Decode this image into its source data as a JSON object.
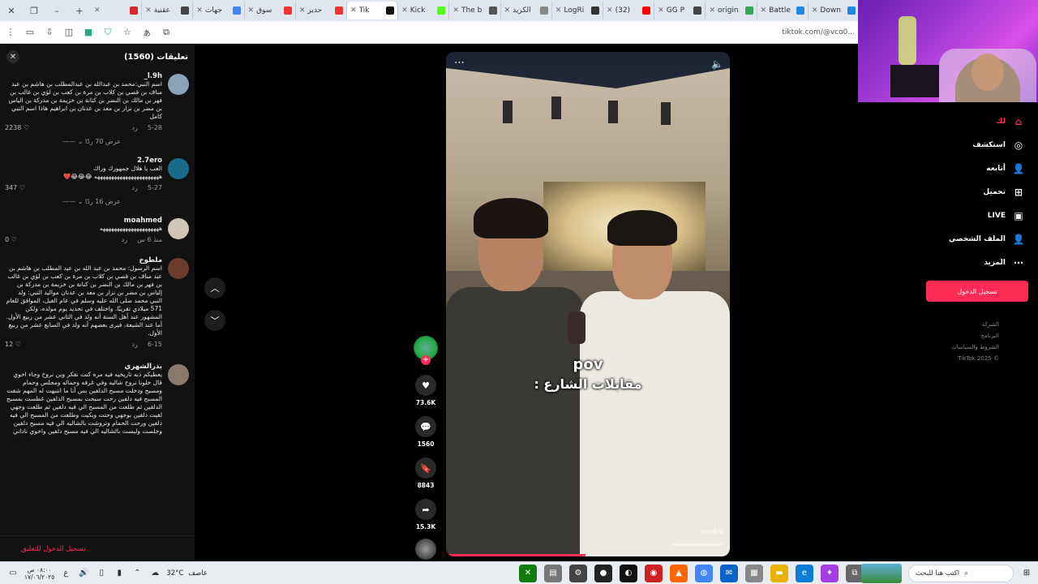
{
  "browser": {
    "tabs": [
      {
        "label": "",
        "color": "#d8262d"
      },
      {
        "label": "عقنية",
        "color": "#444444"
      },
      {
        "label": "جهات",
        "color": "#4285f4"
      },
      {
        "label": "سوق",
        "color": "#e33"
      },
      {
        "label": "حدير",
        "color": "#e33"
      },
      {
        "label": "Tik",
        "color": "#111111",
        "active": true
      },
      {
        "label": "Kick",
        "color": "#53fc18"
      },
      {
        "label": "The b",
        "color": "#555555"
      },
      {
        "label": "الكريد",
        "color": "#888888"
      },
      {
        "label": "LogRi",
        "color": "#333333"
      },
      {
        "label": "(32)",
        "color": "#ff0000"
      },
      {
        "label": "GG P",
        "color": "#444444"
      },
      {
        "label": "origin",
        "color": "#34a853"
      },
      {
        "label": "Battle",
        "color": "#1e88e5"
      },
      {
        "label": "Down",
        "color": "#1e88e5"
      }
    ],
    "url": "tiktok.com/@vco0..."
  },
  "comments": {
    "title": "تعليقات (1560)",
    "items": [
      {
        "user": "l.9h_",
        "text": "اسم النبي:محمد بن عبدالله بن عبدالمطلب بن هاشم بن عبد مناف بن قصي بن كلاب بن مرة بن كعب بن لؤي بن غالب بن فهر بن مالك بن النضر بن كنانة بن خزيمة بن مدركة بن الياس بن مضر بن نزار بن معد بن عدنان بن ابراهيم هاذا اسم النبي كامل",
        "date": "5-28",
        "reply": "رد",
        "likes": "2238",
        "replies_label": "عرض 70 ردًا",
        "avatar_color": "#8aa2b8"
      },
      {
        "user": "2.7ero",
        "text": "العب يا هلال جمهورك وراك",
        "text2": "هههههههههههههههههههههههه 😂😂😂❤️",
        "date": "5-27",
        "reply": "رد",
        "likes": "347",
        "replies_label": "عرض 16 ردًا",
        "avatar_color": "#1a6b8a"
      },
      {
        "user": "moahmed",
        "text": "هههههههههههههههههههههه",
        "date": "منذ 6 س",
        "reply": "رد",
        "likes": "0",
        "avatar_color": "#cfc6b8"
      },
      {
        "user": "ملطوخ",
        "text": "اسم الرسول: محمد بن عبد الله بن عبد المطلب بن هاشم بن عبد مناف بن قصي بن كلاب بن مرة بن كعب بن لؤي بن غالب بن فهر بن مالك بن النضر بن كنانة بن خزيمة بن مدركة بن إلياس بن مضر بن نزار بن معد بن عدنان مواليد النبي: ولد النبي محمد صلى الله عليه وسلم في عام الفيل، الموافق للعام 571 ميلادي تقريبًا. واختلف في تحديد يوم مولده، ولكن المشهور عند أهل السنة أنه ولد في الثاني عشر من ربيع الأول. أما عند الشيعة، فيرى بعضهم أنه ولد في السابع عشر من ربيع الأول.",
        "date": "6-15",
        "reply": "رد",
        "likes": "12",
        "avatar_color": "#6b3b2e"
      },
      {
        "user": "بدرالشهري",
        "text": "يعطيكم ذبه تاريخيه فيه مره كنت نفكر وين نروح وجاء اخوي قال خلونا نروح شاليه وفي غرفه وحماله ومجلس وحمام ومسبح ودخلت مسبح الدلفين بس أنا ما انتبهت له المهم شفت المسبح فيه دلفين رحت سبحت بمسبح الدلفين غطست بمسبح الدلفين ثم طلعت من المسبح الي فيه دلفين ثم طلعت وجهي لقيت دلفين بوجهي وحتت وبكيت وطلعت من المسبح الي فيه دلفين ورحت الحمام وتروشت بالشاليه الي فيه مسبح دلفين وخلصت ولبست بالشاليه الي فيه مسبح دلفين واخوي ناداني",
        "avatar_color": "#8a7a6a"
      }
    ],
    "login_label": "تسجيل الدخول للتعليق"
  },
  "video": {
    "caption_line1": "pov",
    "caption_line2": "مقابلات الشارع :",
    "handle": "vco0.0",
    "handle_sub": "هههههههههههههههههههه",
    "progress": 0.49
  },
  "actions": {
    "likes": "73.6K",
    "comments": "1560",
    "saves": "8843",
    "shares": "15.3K"
  },
  "sidebar": {
    "items": [
      {
        "label": "لك",
        "icon": "home-icon",
        "active": true
      },
      {
        "label": "استكشف",
        "icon": "compass-icon"
      },
      {
        "label": "أتابعه",
        "icon": "following-icon"
      },
      {
        "label": "تحميل",
        "icon": "upload-icon"
      },
      {
        "label": "LIVE",
        "icon": "live-icon"
      },
      {
        "label": "الملف الشخصي",
        "icon": "profile-icon"
      },
      {
        "label": "المزيد",
        "icon": "more-icon"
      }
    ],
    "login_label": "تسجيل الدخول",
    "links": [
      "الشركة",
      "البرنامج",
      "الشروط والسياسات",
      "© 2025 TikTok"
    ]
  },
  "taskbar": {
    "time": "٠٨:٠٠ ص",
    "date": "١٧/٠٦/٢٠٢٥",
    "temperature": "32°C",
    "weather": "عاصف",
    "search_placeholder": "اكتب هنا للبحث"
  }
}
